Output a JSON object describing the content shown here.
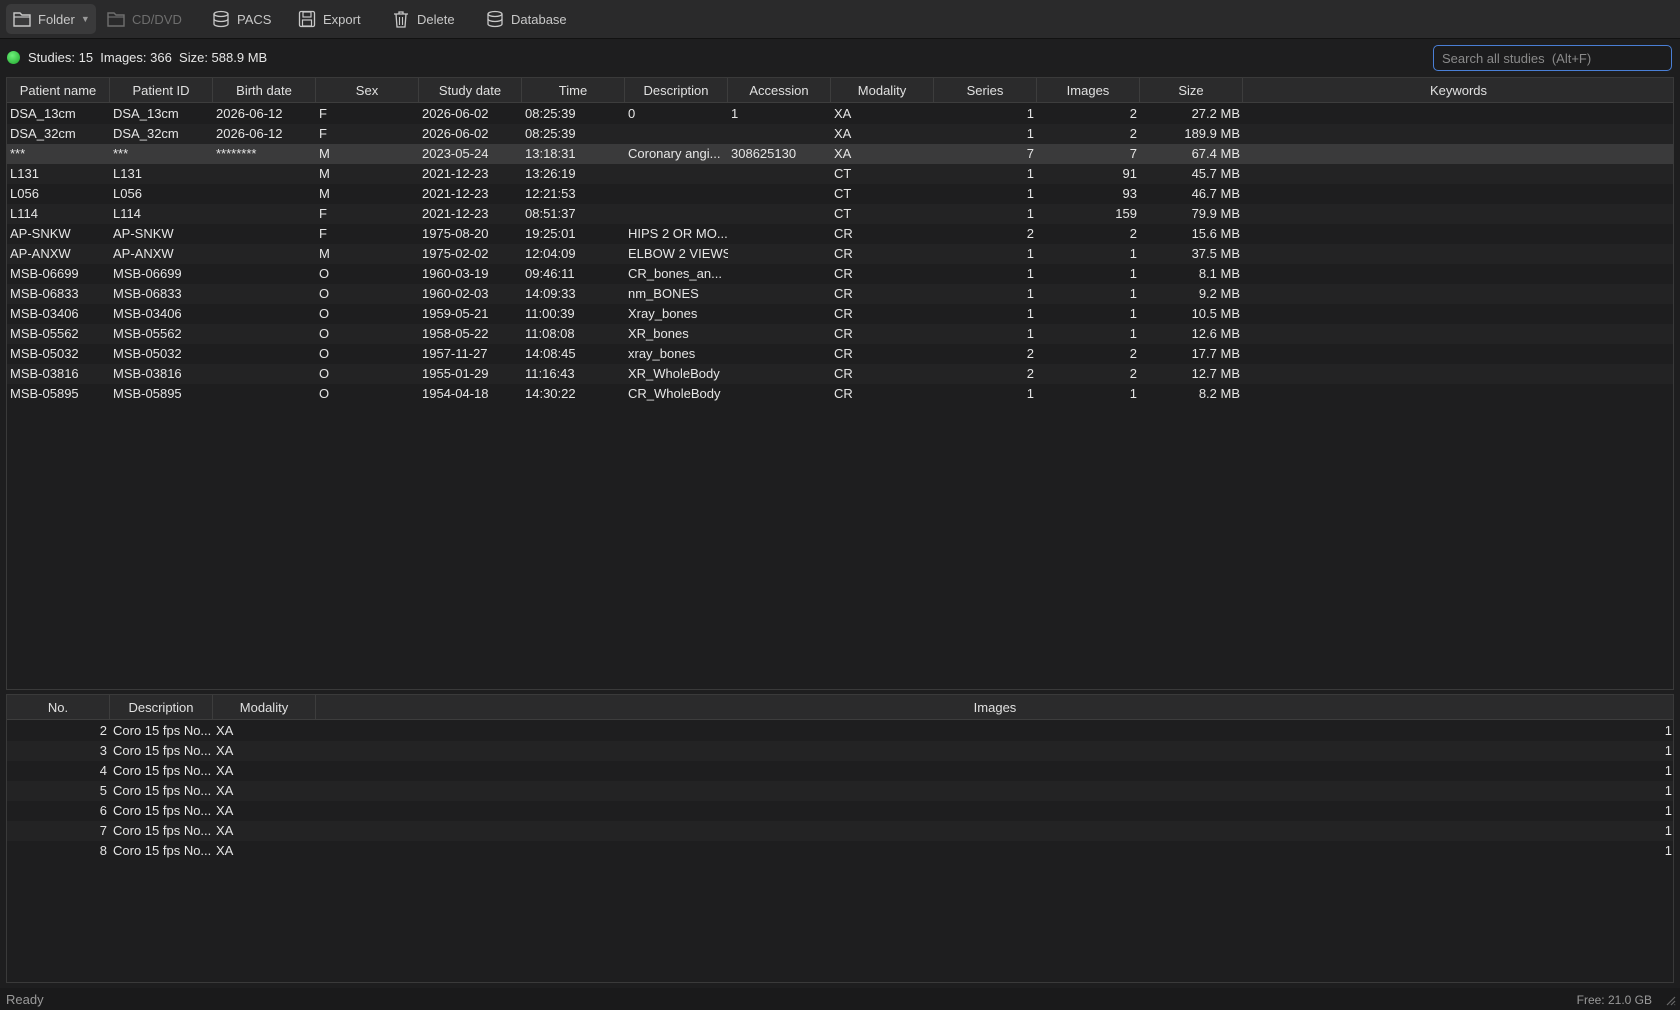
{
  "toolbar": {
    "folder_label": "Folder",
    "cddvd_label": "CD/DVD",
    "pacs_label": "PACS",
    "export_label": "Export",
    "delete_label": "Delete",
    "database_label": "Database"
  },
  "info": {
    "summary": "Studies: 15  Images: 366  Size: 588.9 MB",
    "status_color": "#2ecc40"
  },
  "search": {
    "placeholder": "Search all studies  (Alt+F)",
    "value": ""
  },
  "studies": {
    "columns": [
      "Patient name",
      "Patient ID",
      "Birth date",
      "Sex",
      "Study date",
      "Time",
      "Description",
      "Accession",
      "Modality",
      "Series",
      "Images",
      "Size",
      "Keywords"
    ],
    "rows": [
      [
        "DSA_13cm",
        "DSA_13cm",
        "2026-06-12",
        "F",
        "2026-06-02",
        "08:25:39",
        "0",
        "1",
        "XA",
        "1",
        "2",
        "27.2 MB",
        ""
      ],
      [
        "DSA_32cm",
        "DSA_32cm",
        "2026-06-12",
        "F",
        "2026-06-02",
        "08:25:39",
        "",
        "",
        "XA",
        "1",
        "2",
        "189.9 MB",
        ""
      ],
      [
        "***",
        "***",
        "********",
        "M",
        "2023-05-24",
        "13:18:31",
        "Coronary angi...",
        "308625130",
        "XA",
        "7",
        "7",
        "67.4 MB",
        ""
      ],
      [
        "L131",
        "L131",
        "",
        "M",
        "2021-12-23",
        "13:26:19",
        "",
        "",
        "CT",
        "1",
        "91",
        "45.7 MB",
        ""
      ],
      [
        "L056",
        "L056",
        "",
        "M",
        "2021-12-23",
        "12:21:53",
        "",
        "",
        "CT",
        "1",
        "93",
        "46.7 MB",
        ""
      ],
      [
        "L114",
        "L114",
        "",
        "F",
        "2021-12-23",
        "08:51:37",
        "",
        "",
        "CT",
        "1",
        "159",
        "79.9 MB",
        ""
      ],
      [
        "AP-SNKW",
        "AP-SNKW",
        "",
        "F",
        "1975-08-20",
        "19:25:01",
        "HIPS 2 OR MO...",
        "",
        "CR",
        "2",
        "2",
        "15.6 MB",
        ""
      ],
      [
        "AP-ANXW",
        "AP-ANXW",
        "",
        "M",
        "1975-02-02",
        "12:04:09",
        "ELBOW 2 VIEWS",
        "",
        "CR",
        "1",
        "1",
        "37.5 MB",
        ""
      ],
      [
        "MSB-06699",
        "MSB-06699",
        "",
        "O",
        "1960-03-19",
        "09:46:11",
        "CR_bones_an...",
        "",
        "CR",
        "1",
        "1",
        "8.1 MB",
        ""
      ],
      [
        "MSB-06833",
        "MSB-06833",
        "",
        "O",
        "1960-02-03",
        "14:09:33",
        "nm_BONES",
        "",
        "CR",
        "1",
        "1",
        "9.2 MB",
        ""
      ],
      [
        "MSB-03406",
        "MSB-03406",
        "",
        "O",
        "1959-05-21",
        "11:00:39",
        "Xray_bones",
        "",
        "CR",
        "1",
        "1",
        "10.5 MB",
        ""
      ],
      [
        "MSB-05562",
        "MSB-05562",
        "",
        "O",
        "1958-05-22",
        "11:08:08",
        "XR_bones",
        "",
        "CR",
        "1",
        "1",
        "12.6 MB",
        ""
      ],
      [
        "MSB-05032",
        "MSB-05032",
        "",
        "O",
        "1957-11-27",
        "14:08:45",
        "xray_bones",
        "",
        "CR",
        "2",
        "2",
        "17.7 MB",
        ""
      ],
      [
        "MSB-03816",
        "MSB-03816",
        "",
        "O",
        "1955-01-29",
        "11:16:43",
        "XR_WholeBody",
        "",
        "CR",
        "2",
        "2",
        "12.7 MB",
        ""
      ],
      [
        "MSB-05895",
        "MSB-05895",
        "",
        "O",
        "1954-04-18",
        "14:30:22",
        "CR_WholeBody",
        "",
        "CR",
        "1",
        "1",
        "8.2 MB",
        ""
      ]
    ],
    "selected_index": 2
  },
  "series": {
    "columns": [
      "No.",
      "Description",
      "Modality",
      "Images"
    ],
    "rows": [
      [
        "2",
        "Coro 15 fps No...",
        "XA",
        "1"
      ],
      [
        "3",
        "Coro 15 fps No...",
        "XA",
        "1"
      ],
      [
        "4",
        "Coro 15 fps No...",
        "XA",
        "1"
      ],
      [
        "5",
        "Coro 15 fps No...",
        "XA",
        "1"
      ],
      [
        "6",
        "Coro 15 fps No...",
        "XA",
        "1"
      ],
      [
        "7",
        "Coro 15 fps No...",
        "XA",
        "1"
      ],
      [
        "8",
        "Coro 15 fps No...",
        "XA",
        "1"
      ]
    ]
  },
  "statusbar": {
    "left": "Ready",
    "right": "Free: 21.0 GB"
  },
  "icons": {
    "folder": "folder-icon",
    "cddvd": "folder-icon",
    "pacs": "database-icon",
    "export": "save-icon",
    "delete": "trash-icon",
    "database": "database-icon"
  }
}
